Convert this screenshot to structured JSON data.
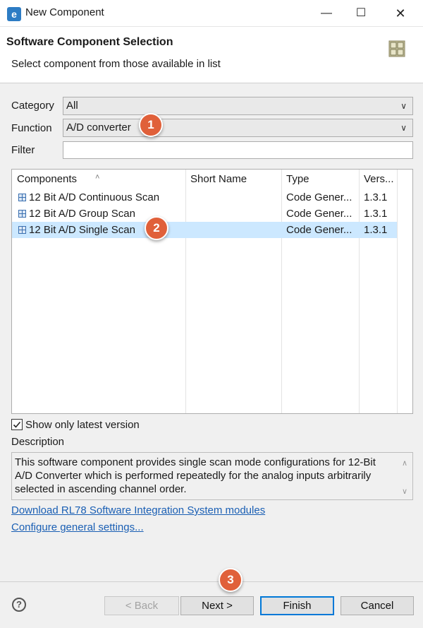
{
  "window": {
    "title": "New Component",
    "icon": "eclipse-app-icon",
    "controls": [
      "minimize-icon",
      "maximize-icon",
      "close-icon"
    ]
  },
  "header": {
    "title": "Software Component Selection",
    "subtitle": "Select component from those available in list",
    "icon": "component-grid-icon"
  },
  "form": {
    "category_label": "Category",
    "category_value": "All",
    "function_label": "Function",
    "function_value": "A/D converter",
    "filter_label": "Filter",
    "filter_value": ""
  },
  "table": {
    "columns": [
      "Components",
      "Short Name",
      "Type",
      "Vers..."
    ],
    "rows": [
      {
        "name": "12 Bit A/D Continuous Scan",
        "short_name": "",
        "type": "Code Gener...",
        "version": "1.3.1",
        "selected": false
      },
      {
        "name": "12 Bit A/D Group Scan",
        "short_name": "",
        "type": "Code Gener...",
        "version": "1.3.1",
        "selected": false
      },
      {
        "name": "12 Bit A/D Single Scan",
        "short_name": "",
        "type": "Code Gener...",
        "version": "1.3.1",
        "selected": true
      }
    ]
  },
  "options": {
    "show_latest_label": "Show only latest version",
    "show_latest_checked": true
  },
  "description": {
    "label": "Description",
    "text": "This software component provides single scan mode configurations for 12-Bit A/D Converter which is performed repeatedly for the analog inputs arbitrarily selected in ascending channel order."
  },
  "links": {
    "download": "Download RL78 Software Integration System modules",
    "configure": "Configure general settings..."
  },
  "buttons": {
    "back": "< Back",
    "next": "Next >",
    "finish": "Finish",
    "cancel": "Cancel"
  },
  "markers": [
    "1",
    "2",
    "3"
  ],
  "colors": {
    "marker": "#e0603a",
    "selection": "#cce8ff",
    "link": "#1a5fb4",
    "default_button_border": "#0078d7"
  }
}
